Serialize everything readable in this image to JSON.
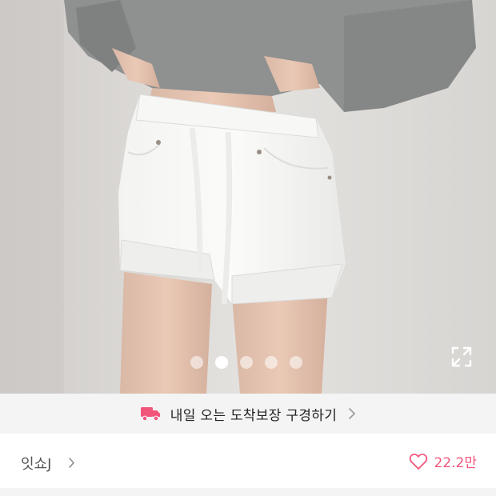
{
  "hero": {
    "image_alt": "white denim drawstring shorts product photo",
    "carousel": {
      "count": 5,
      "active_index": 1
    }
  },
  "banner": {
    "text": "내일 오는 도착보장 구경하기",
    "icon": "delivery-truck-icon",
    "icon_color": "#f2557a"
  },
  "store": {
    "name": "잇쇼J"
  },
  "like": {
    "count": "22.2만",
    "color": "#f2557a"
  }
}
